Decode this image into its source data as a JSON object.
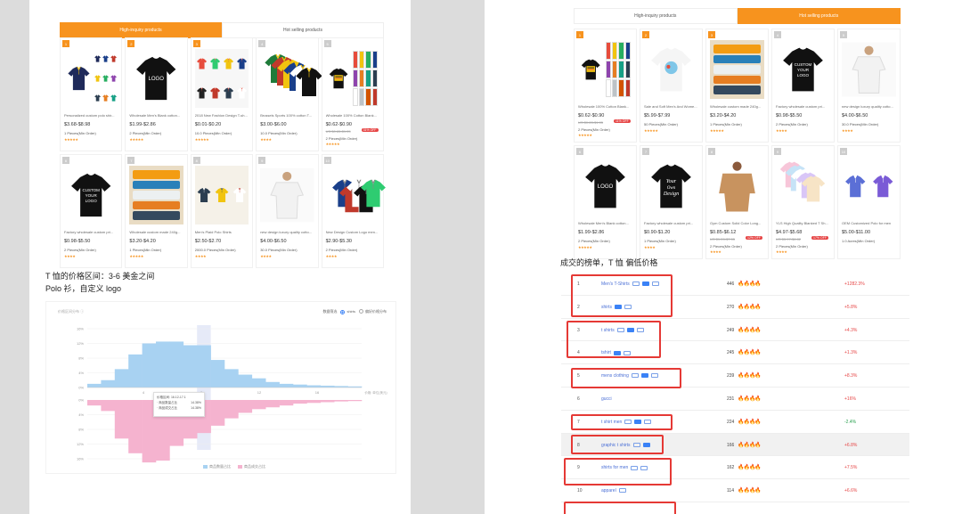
{
  "left_panel": {
    "tabs": [
      {
        "label": "High-inquiry products",
        "active": true
      },
      {
        "label": "Hot selling products",
        "active": false
      }
    ],
    "products": [
      {
        "rank": "1",
        "title": "Personalized custom polo shir...",
        "price": "$3.68-$8.98",
        "moq": "1 Pieces(Min Order)",
        "stars": "★★★★★",
        "img": "polo-multi"
      },
      {
        "rank": "2",
        "title": "Wholesale Men's Blank cotton...",
        "price": "$1.99-$2.86",
        "moq": "2 Pieces(Min Order)",
        "stars": "★★★★★",
        "img": "black-logo"
      },
      {
        "rank": "3",
        "title": "2018 New Fashion Design T-sh...",
        "price": "$0.01-$0.20",
        "moq": "10.0 Pieces(Min Order)",
        "stars": "★★★★★",
        "img": "polo-rack"
      },
      {
        "rank": "4",
        "title": "Brussels Sports 100% cotton T...",
        "price": "$3.00-$6.00",
        "moq": "10.0 Pieces(Min Order)",
        "stars": "★★★★",
        "img": "polo-stack"
      },
      {
        "rank": "5",
        "title": "Wholesale 100% Cotton Blank...",
        "price": "$0.62-$0.90",
        "old": "US $0.83-$1.05",
        "badge": "31% OFF",
        "moq": "2 Pieces(Min Order)",
        "stars": "★★★★★",
        "img": "tee-promo"
      },
      {
        "rank": "6",
        "title": "Factory wholesale custom pri...",
        "price": "$0.98-$5.50",
        "moq": "2 Pieces(Min Order)",
        "stars": "★★★★",
        "img": "black-custom"
      },
      {
        "rank": "7",
        "title": "Wholesale custom made 240g...",
        "price": "$3.20-$4.20",
        "moq": "1 Pieces(Min Order)",
        "stars": "★★★★★",
        "img": "tee-stack"
      },
      {
        "rank": "8",
        "title": "Men's Plaid Polo Shirts",
        "price": "$2.50-$2.70",
        "moq": "2000.0 Pieces(Min Order)",
        "stars": "★★★★",
        "img": "polo-plaid"
      },
      {
        "rank": "9",
        "title": "new design luxury quality cotto...",
        "price": "$4.00-$6.50",
        "moq": "30.0 Pieces(Min Order)",
        "stars": "★★★★",
        "img": "white-model"
      },
      {
        "rank": "10",
        "title": "New Design Custom Logo men...",
        "price": "$2.90-$5.30",
        "moq": "2 Pieces(Min Order)",
        "stars": "★★★★",
        "img": "polo-fan"
      }
    ],
    "note_line1": "T 恤的价格区间：3-6 美金之间",
    "note_line2": "Polo 衫，自定义 logo",
    "chart": {
      "header_title": "价格区间分布 ⓘ",
      "ctl_label": "数据筛选",
      "opt_on": "shirts",
      "opt_off": "偏好价格分布",
      "tooltip_range": "价格区间: 16.12-17.1",
      "tooltip_a_label": "·  商品数量占比",
      "tooltip_a_val": "14.38%",
      "tooltip_b_label": "·  商品成交占比",
      "tooltip_b_val": "14.38%",
      "legend_a": "商品数量占比",
      "legend_b": "商品成交占比",
      "xunit": "价格: 单位(美元)",
      "colors": {
        "upper": "#a8d2f2",
        "lower": "#f5b3cf",
        "hover": "#e6eaf8"
      }
    }
  },
  "chart_data": {
    "type": "bar",
    "title": "价格区间分布",
    "x_ticks": [
      "4",
      "8",
      "12",
      "16"
    ],
    "y_ticks_upper": [
      "16%",
      "12%",
      "8%",
      "4%",
      "0%"
    ],
    "y_ticks_lower": [
      "0%",
      "4%",
      "8%",
      "12%",
      "16%"
    ],
    "series": [
      {
        "name": "商品数量占比",
        "values": [
          1,
          2,
          5,
          9,
          12,
          12.5,
          12.5,
          11.5,
          11.5,
          7.5,
          5,
          3.5,
          2.5,
          1.5,
          1,
          0.8,
          0.6,
          0.5,
          0.4,
          0.3
        ]
      },
      {
        "name": "商品成交占比",
        "values": [
          1.5,
          3,
          10.5,
          14.5,
          17,
          16.5,
          12.5,
          10.5,
          9,
          7,
          5,
          3.5,
          2.5,
          2,
          1.5,
          1,
          0.8,
          0.6,
          0.4,
          0.3
        ]
      }
    ]
  },
  "right_panel": {
    "tabs": [
      {
        "label": "High-inquiry products",
        "active": false
      },
      {
        "label": "Hot selling products",
        "active": true
      }
    ],
    "products": [
      {
        "rank": "1",
        "title": "Wholesale 100% Cotton Blank...",
        "price": "$0.62-$0.90",
        "old": "US $0.83-$1.05",
        "badge": "11% OFF",
        "moq": "2 Pieces(Min Order)",
        "stars": "★★★★★",
        "img": "tee-promo"
      },
      {
        "rank": "2",
        "title": "Sale and Soft Men's And Wome...",
        "price": "$5.99-$7.99",
        "moq": "50 Pieces(Min Order)",
        "stars": "★★★★★",
        "img": "white-print"
      },
      {
        "rank": "3",
        "title": "Wholesale custom made 240g...",
        "price": "$3.20-$4.20",
        "moq": "1 Pieces(Min Order)",
        "stars": "★★★★★",
        "img": "tee-stack"
      },
      {
        "rank": "4",
        "title": "Factory wholesale custom pri...",
        "price": "$0.98-$5.50",
        "moq": "2 Pieces(Min Order)",
        "stars": "★★★★",
        "img": "black-custom"
      },
      {
        "rank": "5",
        "title": "new design luxury quality cotto...",
        "price": "$4.00-$6.50",
        "moq": "30.0 Pieces(Min Order)",
        "stars": "★★★★",
        "img": "white-model"
      },
      {
        "rank": "6",
        "title": "Wholesale Men's Blank cotton...",
        "price": "$1.99-$2.86",
        "moq": "2 Pieces(Min Order)",
        "stars": "★★★★★",
        "img": "black-logo"
      },
      {
        "rank": "7",
        "title": "Factory wholesale custom pri...",
        "price": "$0.90-$1.20",
        "moq": "1 Pieces(Min Order)",
        "stars": "★★★★",
        "img": "black-your-design"
      },
      {
        "rank": "8",
        "title": "Gym Custom Solid Color Long...",
        "price": "$0.85-$6.12",
        "old": "US $1.09-$7.05",
        "badge": "12% OFF",
        "moq": "2 Pieces(Min Order)",
        "stars": "★★★★",
        "img": "model-tan"
      },
      {
        "rank": "9",
        "title": "YLS High Quality Blanked T Sh...",
        "price": "$4.97-$5.68",
        "old": "US $5.97-$6.82",
        "badge": "17% OFF",
        "moq": "2 Pieces(Min Order)",
        "stars": "★★★★",
        "img": "tee-pastel"
      },
      {
        "rank": "10",
        "title": "OEM Customized Polo for men",
        "price": "$5.00-$11.00",
        "moq": "1.0 Acres(Min Order)",
        "stars": "",
        "img": "polo-sport"
      }
    ],
    "note": "成交的榜单，T 恤 偏低价格",
    "keywords": [
      {
        "rank": "1",
        "term": "Men's T-Shirts",
        "icons": [
          "o",
          "f",
          "o"
        ],
        "count": "446",
        "fire": "🔥🔥🔥🔥",
        "change": "+1282.3%",
        "dir": "pos"
      },
      {
        "rank": "2",
        "term": "shirts",
        "icons": [
          "f",
          "o"
        ],
        "count": "270",
        "fire": "🔥🔥🔥🔥",
        "change": "+5.8%",
        "dir": "pos"
      },
      {
        "rank": "3",
        "term": "t shirts",
        "icons": [
          "o",
          "f",
          "o"
        ],
        "count": "249",
        "fire": "🔥🔥🔥🔥",
        "change": "+4.3%",
        "dir": "pos"
      },
      {
        "rank": "4",
        "term": "tshirt",
        "icons": [
          "f",
          "o"
        ],
        "count": "245",
        "fire": "🔥🔥🔥🔥",
        "change": "+1.3%",
        "dir": "pos"
      },
      {
        "rank": "5",
        "term": "mens clothing",
        "icons": [
          "o",
          "f",
          "o"
        ],
        "count": "239",
        "fire": "🔥🔥🔥🔥",
        "change": "+8.3%",
        "dir": "pos"
      },
      {
        "rank": "6",
        "term": "gucci",
        "icons": [],
        "count": "231",
        "fire": "🔥🔥🔥🔥",
        "change": "+16%",
        "dir": "pos"
      },
      {
        "rank": "7",
        "term": "t shirt men",
        "icons": [
          "o",
          "f",
          "o"
        ],
        "count": "224",
        "fire": "🔥🔥🔥🔥",
        "change": "-2.4%",
        "dir": "neg"
      },
      {
        "rank": "8",
        "term": "graphic t shirts",
        "icons": [
          "o",
          "f"
        ],
        "count": "166",
        "fire": "🔥🔥🔥🔥",
        "change": "+6.8%",
        "dir": "pos"
      },
      {
        "rank": "9",
        "term": "shirts for men",
        "icons": [
          "o",
          "o"
        ],
        "count": "162",
        "fire": "🔥🔥🔥🔥",
        "change": "+7.5%",
        "dir": "pos"
      },
      {
        "rank": "10",
        "term": "apparel",
        "icons": [
          "o"
        ],
        "count": "114",
        "fire": "🔥🔥🔥🔥",
        "change": "+6.6%",
        "dir": "pos"
      }
    ]
  }
}
